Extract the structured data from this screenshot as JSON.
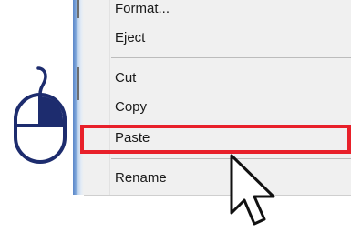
{
  "context_menu": {
    "items": [
      {
        "label": "Format..."
      },
      {
        "label": "Eject"
      },
      {
        "label": "Cut"
      },
      {
        "label": "Copy"
      },
      {
        "label": "Paste",
        "highlighted": true
      },
      {
        "label": "Rename"
      }
    ]
  },
  "icons": {
    "mouse": "mouse-icon",
    "cursor": "arrow-cursor-icon"
  },
  "colors": {
    "highlight_border": "#e8202a",
    "mouse_icon": "#1d2c6e",
    "menu_background": "#f0f0f0"
  }
}
